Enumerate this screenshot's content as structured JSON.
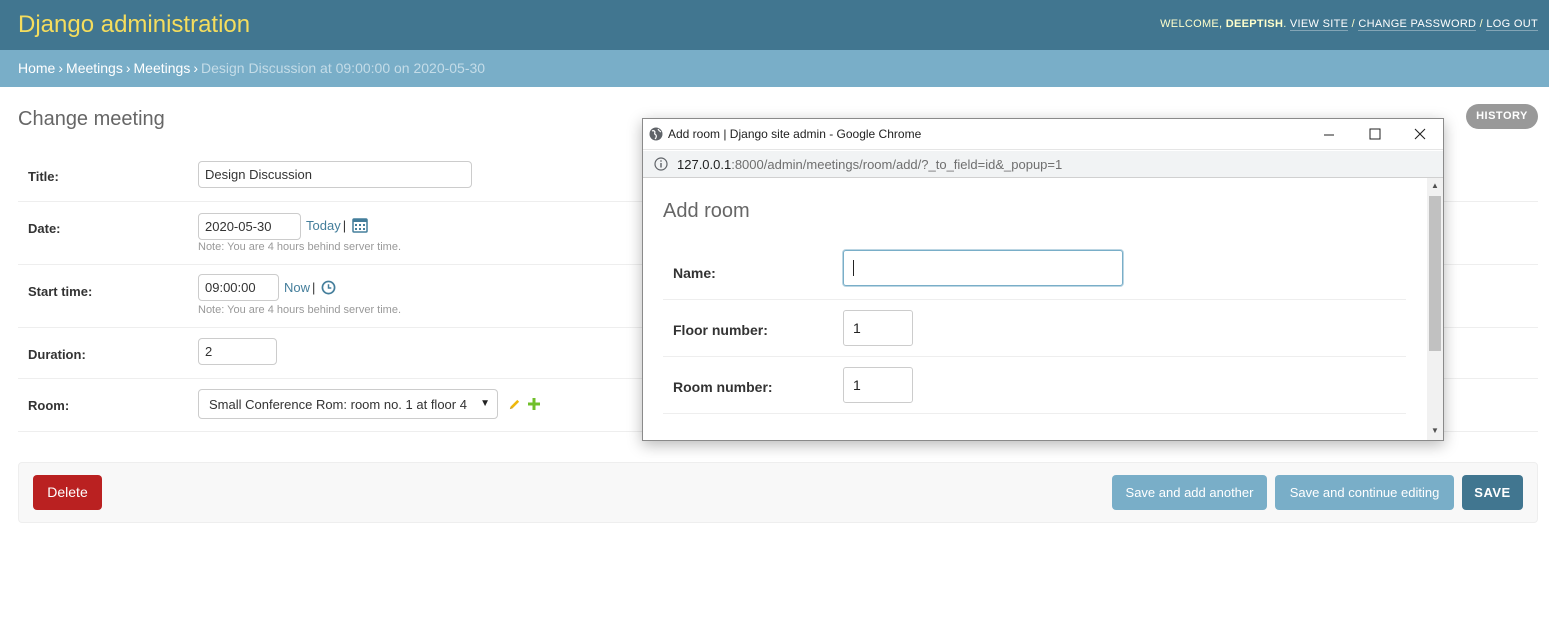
{
  "header": {
    "branding": "Django administration",
    "welcome": "Welcome,",
    "username": "deeptish",
    "view_site": "View site",
    "change_password": "Change password",
    "log_out": "Log out"
  },
  "breadcrumbs": {
    "home": "Home",
    "app": "Meetings",
    "model": "Meetings",
    "current": "Design Discussion at 09:00:00 on 2020-05-30"
  },
  "page": {
    "title": "Change meeting",
    "history": "HISTORY"
  },
  "form": {
    "title_label": "Title:",
    "title_value": "Design Discussion",
    "date_label": "Date:",
    "date_value": "2020-05-30",
    "today": "Today",
    "date_help": "Note: You are 4 hours behind server time.",
    "start_label": "Start time:",
    "start_value": "09:00:00",
    "now": "Now",
    "start_help": "Note: You are 4 hours behind server time.",
    "duration_label": "Duration:",
    "duration_value": "2",
    "room_label": "Room:",
    "room_value": "Small Conference Rom: room no. 1 at floor 4"
  },
  "actions": {
    "delete": "Delete",
    "save_add": "Save and add another",
    "save_continue": "Save and continue editing",
    "save": "SAVE"
  },
  "popup": {
    "window_title": "Add room | Django site admin - Google Chrome",
    "url_host": "127.0.0.1",
    "url_rest": ":8000/admin/meetings/room/add/?_to_field=id&_popup=1",
    "heading": "Add room",
    "name_label": "Name:",
    "name_value": "",
    "floor_label": "Floor number:",
    "floor_value": "1",
    "room_label": "Room number:",
    "room_value": "1"
  },
  "colors": {
    "header_bg": "#417690",
    "branding": "#f5dd5d",
    "breadcrumb_bg": "#79aec8",
    "delete": "#ba2121",
    "save": "#417690",
    "secondary_button": "#79aec8",
    "link": "#447e9b",
    "focus": "#79aec8"
  },
  "icons": {
    "calendar": "calendar-icon",
    "clock": "clock-icon",
    "edit": "pencil-icon",
    "add": "plus-icon",
    "select_arrow": "caret-down-icon",
    "globe": "globe-icon",
    "info": "info-icon"
  }
}
